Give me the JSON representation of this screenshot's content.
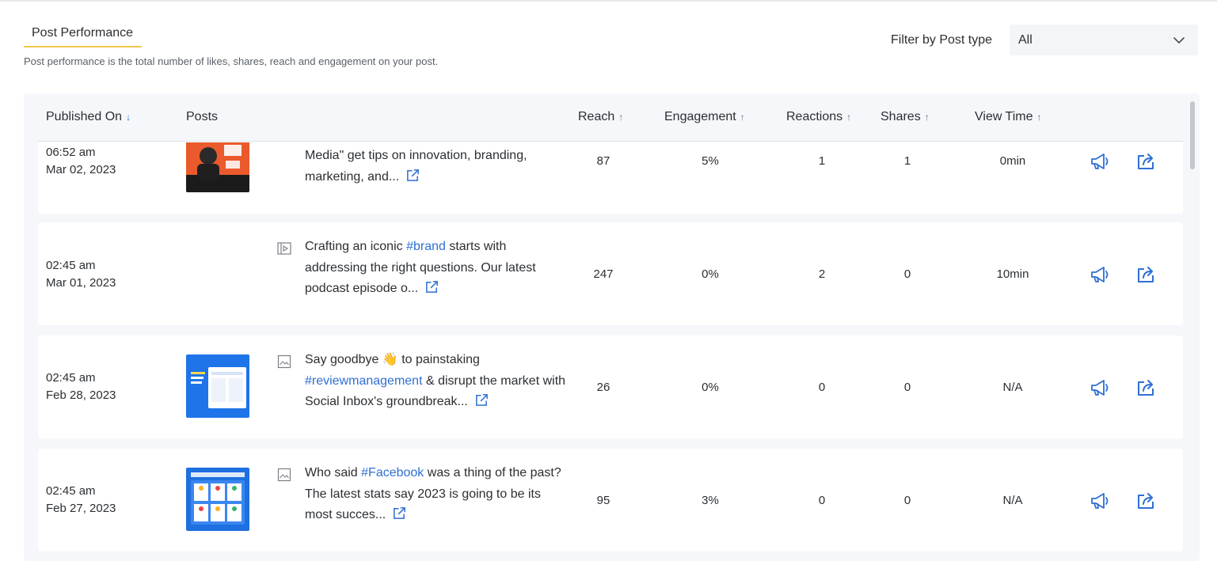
{
  "section": {
    "tab_label": "Post Performance",
    "description": "Post performance is the total number of likes, shares, reach and engagement on your post."
  },
  "filter": {
    "label": "Filter by Post type",
    "selected": "All"
  },
  "table": {
    "columns": {
      "published_on": "Published On",
      "published_on_sort": "↓",
      "posts": "Posts",
      "reach": "Reach",
      "reach_sort": "↑",
      "engagement": "Engagement",
      "engagement_sort": "↑",
      "reactions": "Reactions",
      "reactions_sort": "↑",
      "shares": "Shares",
      "shares_sort": "↑",
      "view_time": "View Time",
      "view_time_sort": "↑"
    },
    "rows": [
      {
        "time": "06:52 am",
        "date": "Mar 02, 2023",
        "text_before": "Media\" get tips on innovation, branding, marketing, and...",
        "hashtag": "",
        "text_after": "",
        "reach": "87",
        "engagement": "5%",
        "reactions": "1",
        "shares": "1",
        "view_time": "0min"
      },
      {
        "time": "02:45 am",
        "date": "Mar 01, 2023",
        "text_before": "Crafting an iconic ",
        "hashtag": "#brand",
        "text_after": " starts with addressing the right questions. Our latest podcast episode o...",
        "reach": "247",
        "engagement": "0%",
        "reactions": "2",
        "shares": "0",
        "view_time": "10min"
      },
      {
        "time": "02:45 am",
        "date": "Feb 28, 2023",
        "text_before": "Say goodbye 👋 to painstaking ",
        "hashtag": "#reviewmanagement",
        "text_after": " & disrupt the market with Social Inbox's groundbreak...",
        "reach": "26",
        "engagement": "0%",
        "reactions": "0",
        "shares": "0",
        "view_time": "N/A"
      },
      {
        "time": "02:45 am",
        "date": "Feb 27, 2023",
        "text_before": "Who said ",
        "hashtag": "#Facebook",
        "text_after": " was a thing of the past? The latest stats say 2023 is going to be its most succes...",
        "reach": "95",
        "engagement": "3%",
        "reactions": "0",
        "shares": "0",
        "view_time": "N/A"
      }
    ]
  },
  "icons": {
    "sort_down": "arrow-down-icon",
    "sort_up": "arrow-up-icon",
    "dropdown": "chevron-down-icon",
    "video_type": "video-icon",
    "image_type": "image-icon",
    "open_external": "external-link-icon",
    "boost": "megaphone-icon",
    "share": "share-icon"
  },
  "colors": {
    "accent_underline": "#f2c84b",
    "hashtag": "#2f6fd4",
    "action_icons": "#2f6fd4",
    "table_bg": "#f5f7fa"
  }
}
